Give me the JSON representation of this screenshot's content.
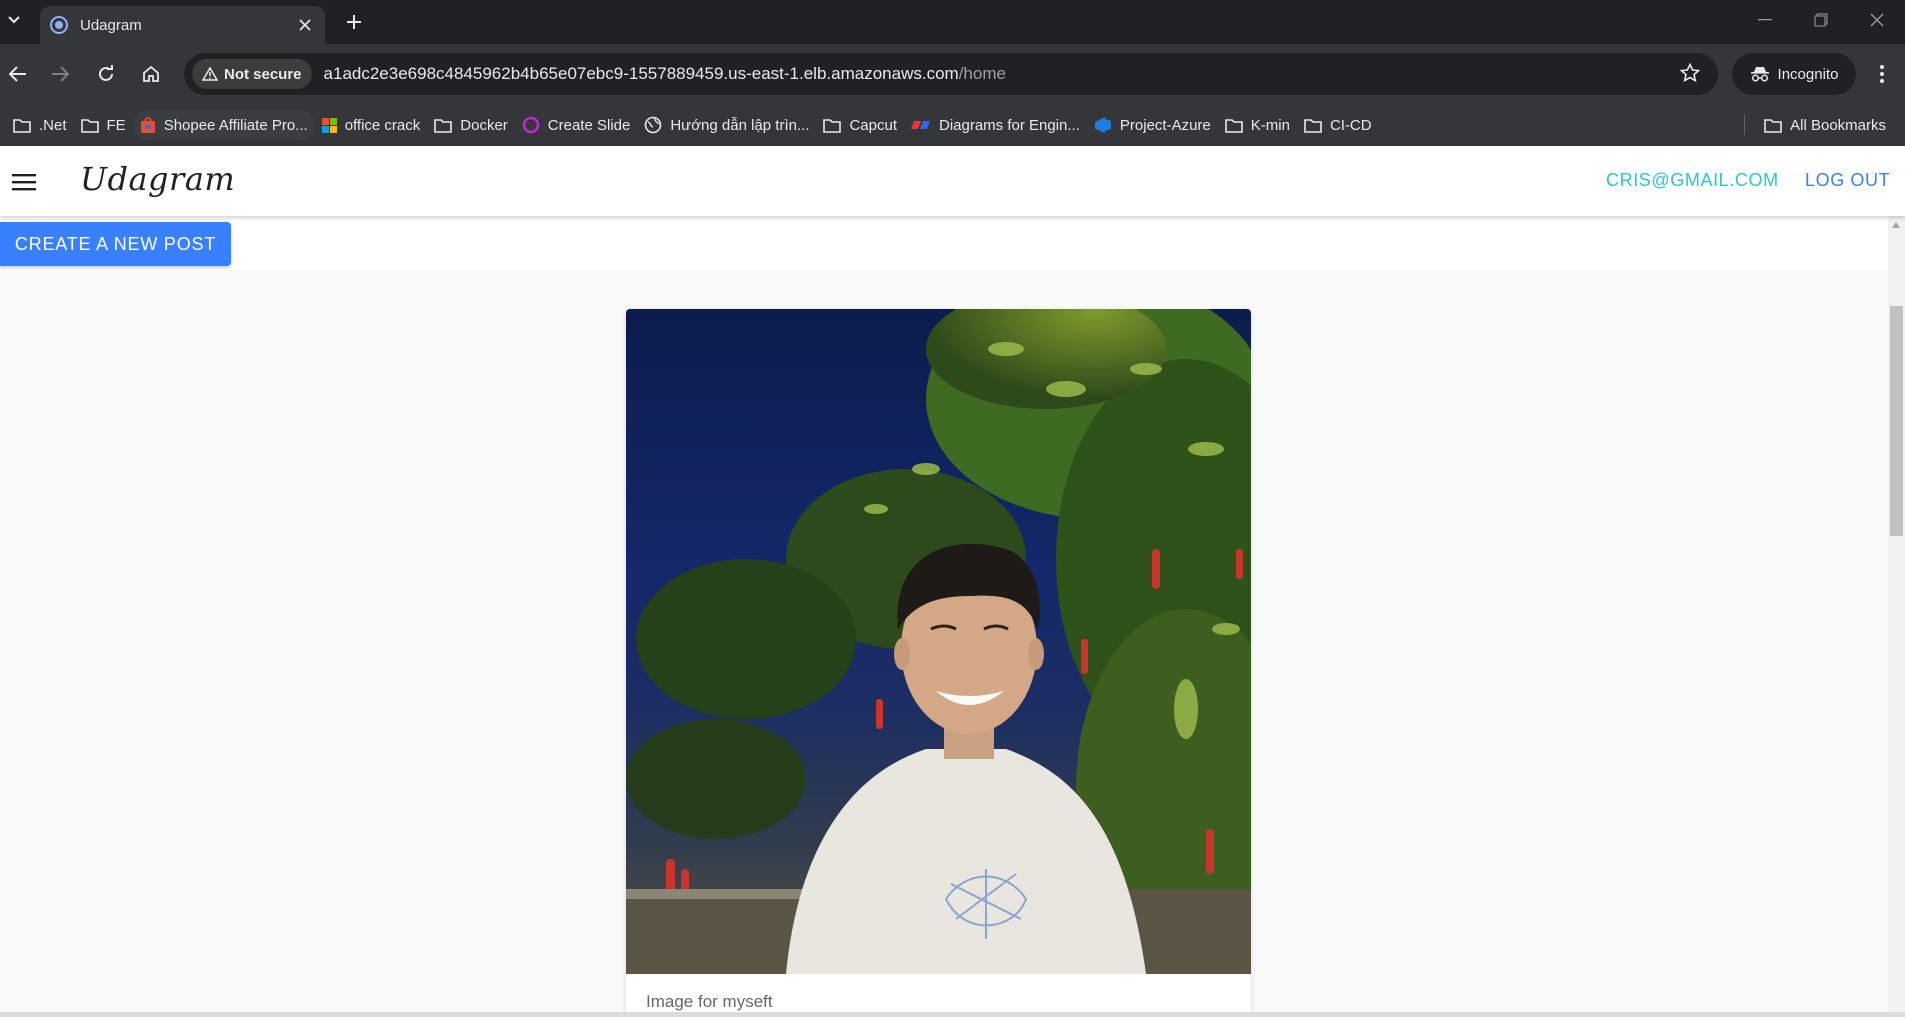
{
  "browser": {
    "tab_title": "Udagram",
    "security_label": "Not secure",
    "url_host": "a1adc2e3e698c4845962b4b65e07ebc9-1557889459.us-east-1.elb.amazonaws.com",
    "url_path": "/home",
    "profile_label": "Incognito",
    "bookmarks": [
      {
        "label": ".Net",
        "icon": "folder-icon"
      },
      {
        "label": "FE",
        "icon": "folder-icon"
      },
      {
        "label": "Shopee Affiliate Pro...",
        "icon": "shopee-icon"
      },
      {
        "label": "office crack",
        "icon": "microsoft-icon"
      },
      {
        "label": "Docker",
        "icon": "folder-icon"
      },
      {
        "label": "Create Slide",
        "icon": "slide-icon"
      },
      {
        "label": "Hướng dẫn lập trìn...",
        "icon": "globe-icon"
      },
      {
        "label": "Capcut",
        "icon": "folder-icon"
      },
      {
        "label": "Diagrams for Engin...",
        "icon": "diagrams-icon"
      },
      {
        "label": "Project-Azure",
        "icon": "azure-devops-icon"
      },
      {
        "label": "K-min",
        "icon": "folder-icon"
      },
      {
        "label": "CI-CD",
        "icon": "folder-icon"
      }
    ],
    "all_bookmarks_label": "All Bookmarks"
  },
  "app": {
    "brand": "Udagram",
    "user_email": "CRIS@GMAIL.COM",
    "logout_label": "LOG OUT",
    "create_post_label": "CREATE A NEW POST",
    "feed": [
      {
        "caption": "Image for myseft"
      }
    ]
  },
  "colors": {
    "primary": "#3880ff",
    "secondary": "#2bc5d8",
    "chrome_dark": "#202124",
    "chrome_toolbar": "#35363a"
  }
}
